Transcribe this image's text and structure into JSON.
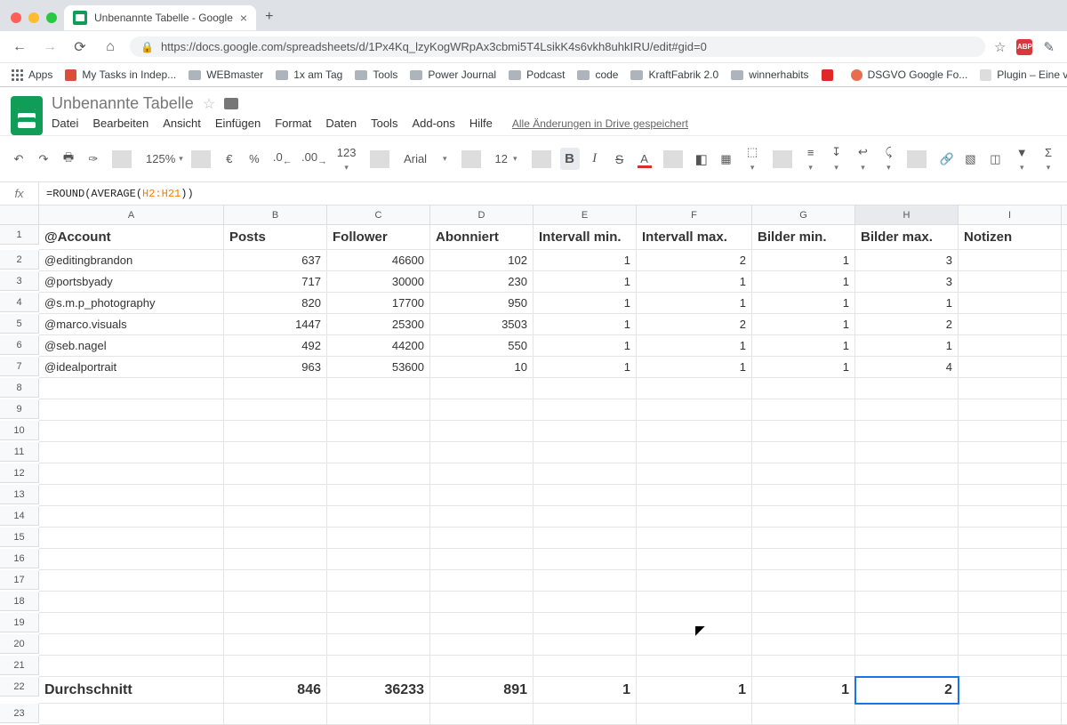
{
  "browser": {
    "tab_title": "Unbenannte Tabelle - Google",
    "url": "https://docs.google.com/spreadsheets/d/1Px4Kq_lzyKogWRpAx3cbmi5T4LsikK4s6vkh8uhkIRU/edit#gid=0",
    "bookmarks": [
      "Apps",
      "My Tasks in Indep...",
      "WEBmaster",
      "1x am Tag",
      "Tools",
      "Power Journal",
      "Podcast",
      "code",
      "KraftFabrik 2.0",
      "winnerhabits",
      "",
      "DSGVO Google Fo...",
      "Plugin – Eine v"
    ]
  },
  "doc": {
    "title": "Unbenannte Tabelle",
    "menus": [
      "Datei",
      "Bearbeiten",
      "Ansicht",
      "Einfügen",
      "Format",
      "Daten",
      "Tools",
      "Add-ons",
      "Hilfe"
    ],
    "save_status": "Alle Änderungen in Drive gespeichert"
  },
  "toolbar": {
    "zoom": "125%",
    "currency": "€",
    "percent": "%",
    "dec_less": ".0",
    "dec_more": ".00",
    "numfmt": "123",
    "font": "Arial",
    "size": "12"
  },
  "formula": {
    "prefix": "=ROUND(AVERAGE(",
    "range": "H2:H21",
    "suffix": "))"
  },
  "columns": [
    "A",
    "B",
    "C",
    "D",
    "E",
    "F",
    "G",
    "H",
    "I"
  ],
  "headers": [
    "@Account",
    "Posts",
    "Follower",
    "Abonniert",
    "Intervall min.",
    "Intervall max.",
    "Bilder min.",
    "Bilder max.",
    "Notizen"
  ],
  "rows": [
    {
      "a": "@editingbrandon",
      "b": "637",
      "c": "46600",
      "d": "102",
      "e": "1",
      "f": "2",
      "g": "1",
      "h": "3"
    },
    {
      "a": "@portsbyady",
      "b": "717",
      "c": "30000",
      "d": "230",
      "e": "1",
      "f": "1",
      "g": "1",
      "h": "3"
    },
    {
      "a": "@s.m.p_photography",
      "b": "820",
      "c": "17700",
      "d": "950",
      "e": "1",
      "f": "1",
      "g": "1",
      "h": "1"
    },
    {
      "a": "@marco.visuals",
      "b": "1447",
      "c": "25300",
      "d": "3503",
      "e": "1",
      "f": "2",
      "g": "1",
      "h": "2"
    },
    {
      "a": "@seb.nagel",
      "b": "492",
      "c": "44200",
      "d": "550",
      "e": "1",
      "f": "1",
      "g": "1",
      "h": "1"
    },
    {
      "a": "@idealportrait",
      "b": "963",
      "c": "53600",
      "d": "10",
      "e": "1",
      "f": "1",
      "g": "1",
      "h": "4"
    }
  ],
  "avg_label": "Durchschnitt",
  "avg": {
    "b": "846",
    "c": "36233",
    "d": "891",
    "e": "1",
    "f": "1",
    "g": "1",
    "h": "2"
  },
  "active_cell": "H22"
}
